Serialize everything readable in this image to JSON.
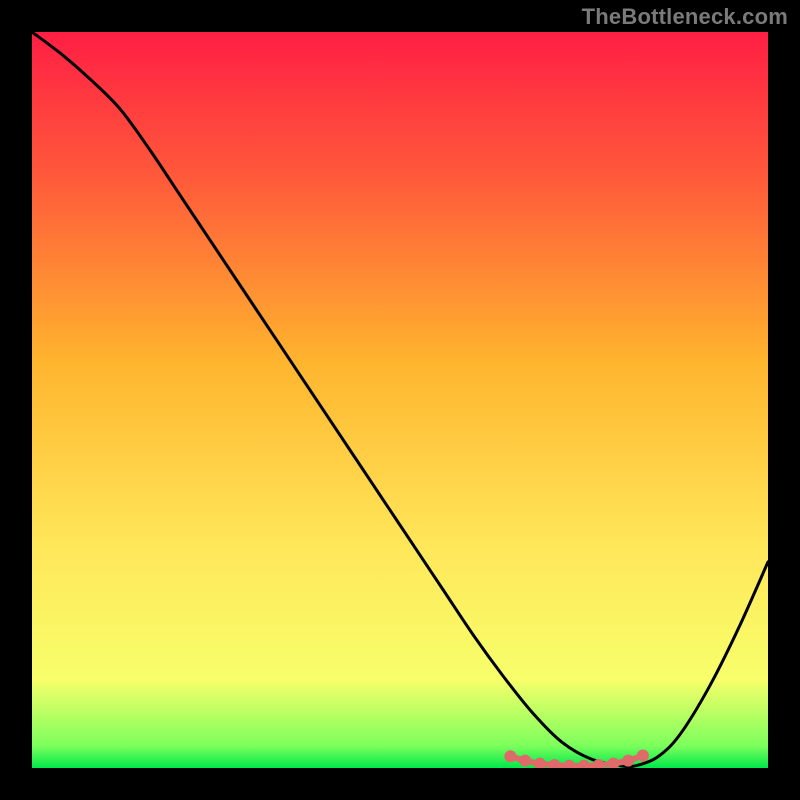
{
  "watermark": "TheBottleneck.com",
  "chart_data": {
    "type": "line",
    "title": "",
    "xlabel": "",
    "ylabel": "",
    "xlim": [
      0,
      100
    ],
    "ylim": [
      0,
      100
    ],
    "grid": false,
    "legend": false,
    "gradient_stops": [
      {
        "offset": 0.0,
        "color": "#ff1f44"
      },
      {
        "offset": 0.2,
        "color": "#ff5a3a"
      },
      {
        "offset": 0.45,
        "color": "#ffb52e"
      },
      {
        "offset": 0.7,
        "color": "#ffe75a"
      },
      {
        "offset": 0.88,
        "color": "#f7ff6a"
      },
      {
        "offset": 0.97,
        "color": "#7cff5c"
      },
      {
        "offset": 1.0,
        "color": "#00e84a"
      }
    ],
    "series": [
      {
        "name": "bottleneck-curve",
        "color": "#000000",
        "x": [
          0,
          4,
          8,
          12,
          16,
          20,
          24,
          28,
          32,
          36,
          40,
          44,
          48,
          52,
          56,
          60,
          64,
          68,
          72,
          76,
          80,
          82,
          85,
          88,
          92,
          96,
          100
        ],
        "y": [
          100,
          97,
          93.5,
          89.5,
          84,
          78,
          72,
          66,
          60,
          54,
          48,
          42,
          36,
          30,
          24,
          18,
          12.5,
          7.5,
          3.5,
          1.2,
          0.3,
          0.3,
          1.5,
          4.5,
          11,
          19,
          28
        ]
      },
      {
        "name": "bottleneck-zone",
        "color": "#e06a6a",
        "marker": true,
        "x": [
          65,
          67,
          69,
          71,
          73,
          75,
          77,
          79,
          81,
          83
        ],
        "y": [
          1.6,
          1.0,
          0.6,
          0.4,
          0.3,
          0.3,
          0.4,
          0.6,
          1.0,
          1.7
        ]
      }
    ],
    "annotations": []
  }
}
